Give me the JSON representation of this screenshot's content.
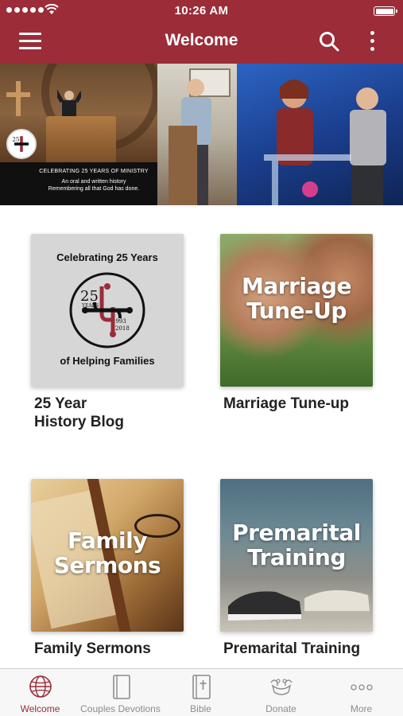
{
  "status_bar": {
    "time": "10:26 AM"
  },
  "header": {
    "title": "Welcome"
  },
  "hero": {
    "banner_line1": "CELEBRATING 25 YEARS OF MINISTRY",
    "banner_line2": "An oral and written history",
    "banner_line3": "Remembering all that God has done.",
    "logo_number": "25",
    "logo_years": "YEARS",
    "logo_range": "1993-2018"
  },
  "tiles": [
    {
      "label_line1": "25 Year",
      "label_line2": "History Blog",
      "image_top_text": "Celebrating 25 Years",
      "image_bottom_text": "of Helping Families",
      "emblem_number": "25",
      "emblem_years": "YEARS",
      "emblem_start": "1993",
      "emblem_end": "2018"
    },
    {
      "label": "Marriage Tune-up",
      "image_line1": "Marriage",
      "image_line2": "Tune-Up"
    },
    {
      "label": "Family Sermons",
      "image_line1": "Family",
      "image_line2": "Sermons"
    },
    {
      "label": "Premarital Training",
      "image_line1": "Premarital",
      "image_line2": "Training"
    }
  ],
  "tabbar": {
    "active": "Welcome",
    "items": [
      {
        "label": "Welcome",
        "icon": "globe-icon"
      },
      {
        "label": "Couples Devotions",
        "icon": "book-icon"
      },
      {
        "label": "Bible",
        "icon": "bible-cross-icon"
      },
      {
        "label": "Donate",
        "icon": "donate-hands-icon"
      },
      {
        "label": "More",
        "icon": "more-dots-icon"
      }
    ]
  },
  "colors": {
    "brand": "#9b2c38",
    "tab_inactive": "#8c8c8c"
  }
}
